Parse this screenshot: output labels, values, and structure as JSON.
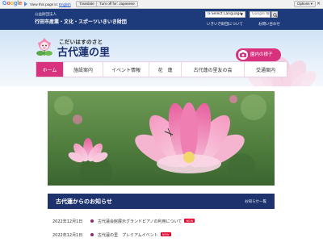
{
  "google_bar": {
    "logo": "Google",
    "view_text": "View this page in:",
    "language_link": "English",
    "translate_button": "Translate",
    "turn_off_button": "Turn off for: Japanese",
    "options_button": "Options ▾",
    "close": "✕"
  },
  "header": {
    "org_small": "公益財団法人",
    "org_name": "行田市産業・文化・スポーツいきいき財団",
    "language_select": "Select Language",
    "search_placeholder": "Google 検索",
    "links": [
      "いきいき財団について",
      "お問い合わせ"
    ]
  },
  "brand": {
    "tagline": "こだいはすのさと",
    "title": "古代蓮の里",
    "garden_button": "園内の様子"
  },
  "nav": {
    "items": [
      "ホーム",
      "施設案内",
      "イベント情報",
      "花　蓮",
      "古代蓮の里友の会",
      "交通案内"
    ],
    "active_index": 0
  },
  "slideshow": {
    "dot_count": 3,
    "active_dot": 0
  },
  "news": {
    "title": "古代蓮からのお知らせ",
    "more": "お知らせ一覧",
    "items": [
      {
        "date": "2022年12月1日",
        "text": "古代蓮会館展示グランドピアノの利用について",
        "badge": "NEW"
      },
      {
        "date": "2022年12月1日",
        "text": "古代蓮の里　プレミアムイベント",
        "badge": "NEW"
      }
    ]
  },
  "colors": {
    "navy": "#1d3a7a",
    "accent_pink": "#d8327f"
  }
}
